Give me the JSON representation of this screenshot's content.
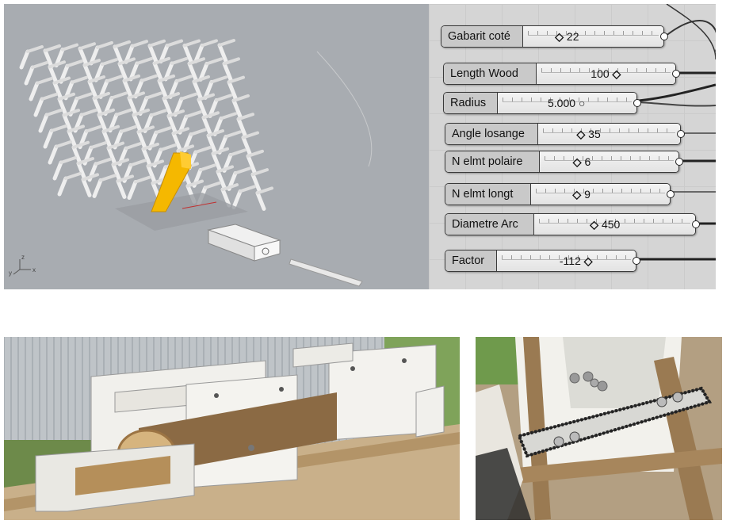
{
  "viewport": {
    "axes": {
      "z": "z",
      "y": "y",
      "x": "x"
    },
    "colors": {
      "background": "#a8acb1",
      "selected": "#f5b800",
      "timber": "#e6e6e6"
    }
  },
  "grasshopper": {
    "sliders": [
      {
        "name": "Gabarit coté",
        "value": "22",
        "grip": "diamond",
        "position": 0.28
      },
      {
        "name": "Length Wood",
        "value": "100",
        "grip": "diamond",
        "position": 0.55
      },
      {
        "name": "Radius",
        "value": "5.000",
        "grip": "circle",
        "position": 0.5
      },
      {
        "name": "Angle losange",
        "value": "35",
        "grip": "diamond",
        "position": 0.35
      },
      {
        "name": "N elmt polaire",
        "value": "6",
        "grip": "diamond",
        "position": 0.3
      },
      {
        "name": "N elmt longt",
        "value": "9",
        "grip": "diamond",
        "position": 0.4
      },
      {
        "name": "Diametre Arc",
        "value": "450",
        "grip": "diamond",
        "position": 0.45
      },
      {
        "name": "Factor",
        "value": "-112",
        "grip": "diamond",
        "position": 0.65
      }
    ]
  },
  "photos": {
    "jig": {
      "subject": "wooden cutting jig with log"
    },
    "chain": {
      "subject": "chainsaw bar and chain"
    }
  }
}
